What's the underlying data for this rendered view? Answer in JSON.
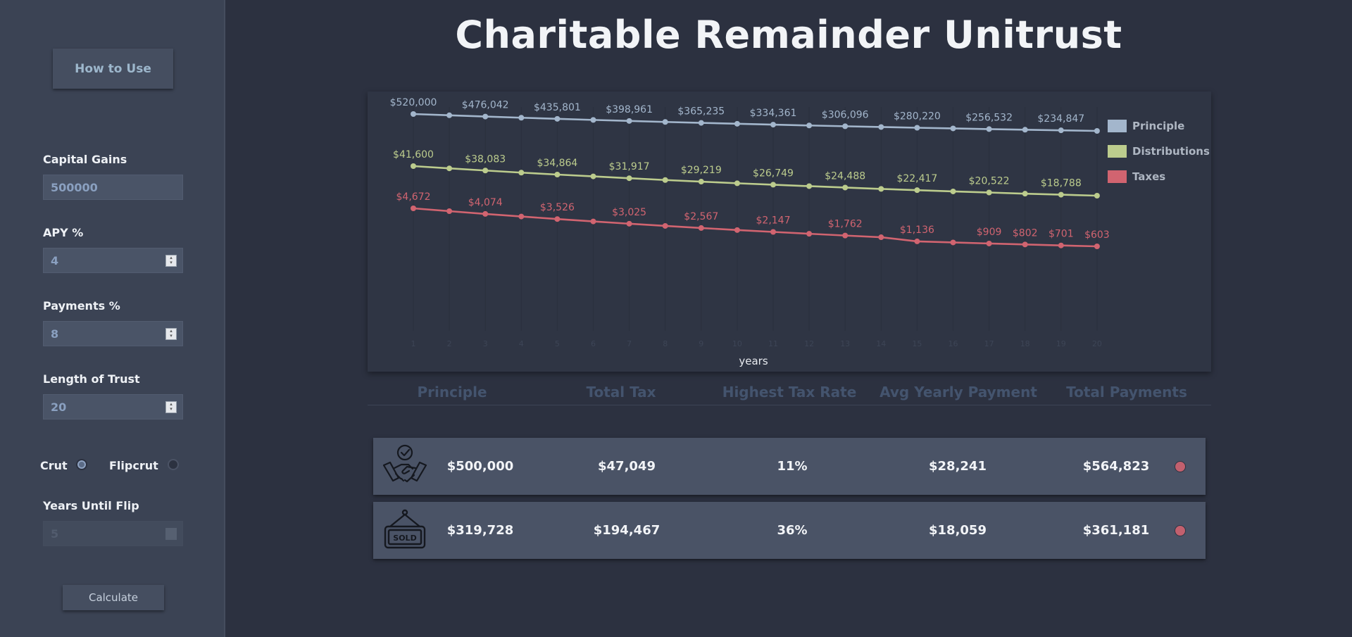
{
  "title": "Charitable Remainder Unitrust",
  "sidebar": {
    "how_to_use": "How to Use",
    "fields": [
      {
        "label": "Capital Gains",
        "value": "500000"
      },
      {
        "label": "APY %",
        "value": "4"
      },
      {
        "label": "Payments %",
        "value": "8"
      },
      {
        "label": "Length of Trust",
        "value": "20"
      }
    ],
    "mode": {
      "crut_label": "Crut",
      "flipcrut_label": "Flipcrut",
      "selected": "Crut"
    },
    "years_until_flip": {
      "label": "Years Until Flip",
      "value": "5",
      "disabled": true
    },
    "calculate": "Calculate"
  },
  "stats": {
    "headers": [
      "Principle",
      "Total Tax",
      "Highest Tax Rate",
      "Avg Yearly Payment",
      "Total Payments"
    ],
    "rows": [
      {
        "icon": "handshake-icon",
        "principle": "$500,000",
        "total_tax": "$47,049",
        "highest_tax_rate": "11%",
        "avg_yearly_payment": "$28,241",
        "total_payments": "$564,823"
      },
      {
        "icon": "sold-sign-icon",
        "sold_text": "SOLD",
        "principle": "$319,728",
        "total_tax": "$194,467",
        "highest_tax_rate": "36%",
        "avg_yearly_payment": "$18,059",
        "total_payments": "$361,181"
      }
    ]
  },
  "colors": {
    "principle": "#a3b6cc",
    "distributions": "#bccc8d",
    "taxes": "#d16470",
    "status_dot": "#c2606e"
  },
  "chart_data": {
    "type": "line",
    "x": [
      1,
      2,
      3,
      4,
      5,
      6,
      7,
      8,
      9,
      10,
      11,
      12,
      13,
      14,
      15,
      16,
      17,
      18,
      19,
      20
    ],
    "xlabel": "years",
    "series": [
      {
        "name": "Principle",
        "values": [
          520000,
          498000,
          476042,
          455500,
          435801,
          417000,
          398961,
          381700,
          365235,
          349500,
          334361,
          319900,
          306096,
          292900,
          280220,
          268100,
          256532,
          245500,
          234847,
          224700
        ],
        "labels": {
          "1": "$520,000",
          "3": "$476,042",
          "5": "$435,801",
          "7": "$398,961",
          "9": "$365,235",
          "11": "$334,361",
          "13": "$306,096",
          "15": "$280,220",
          "17": "$256,532",
          "19": "$234,847"
        }
      },
      {
        "name": "Distributions",
        "values": [
          41600,
          39800,
          38083,
          36400,
          34864,
          33400,
          31917,
          30500,
          29219,
          27900,
          26749,
          25600,
          24488,
          23400,
          22417,
          21400,
          20522,
          19600,
          18788,
          18000
        ],
        "labels": {
          "1": "$41,600",
          "3": "$38,083",
          "5": "$34,864",
          "7": "$31,917",
          "9": "$29,219",
          "11": "$26,749",
          "13": "$24,488",
          "15": "$22,417",
          "17": "$20,522",
          "19": "$18,788"
        }
      },
      {
        "name": "Taxes",
        "values": [
          4672,
          4370,
          4074,
          3800,
          3526,
          3270,
          3025,
          2790,
          2567,
          2350,
          2147,
          1950,
          1762,
          1580,
          1136,
          1020,
          909,
          802,
          701,
          603
        ],
        "labels": {
          "1": "$4,672",
          "3": "$4,074",
          "5": "$3,526",
          "7": "$3,025",
          "9": "$2,567",
          "11": "$2,147",
          "13": "$1,762",
          "15": "$1,136",
          "17": "$909",
          "18": "$802",
          "19": "$701",
          "20": "$603"
        }
      }
    ],
    "legend_position": "right",
    "grid": false
  }
}
